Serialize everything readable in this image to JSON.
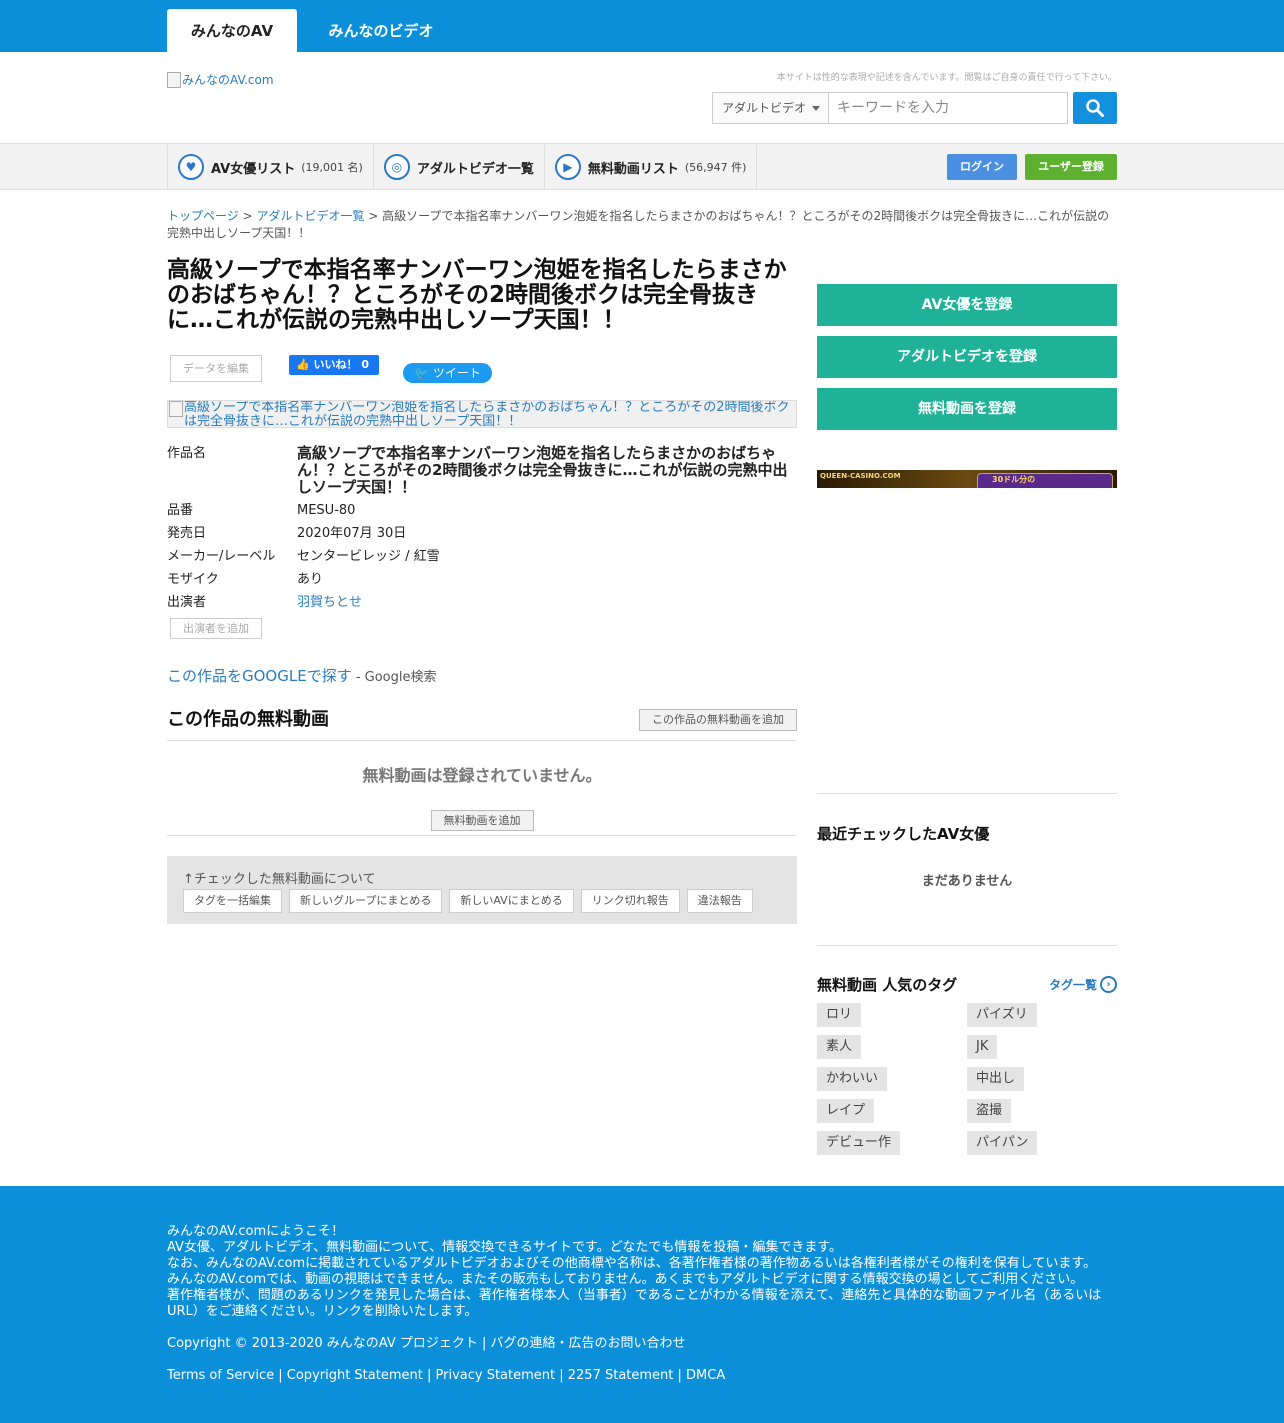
{
  "tabs": {
    "active": "みんなのAV",
    "inactive": "みんなのビデオ"
  },
  "header": {
    "logo_alt": "みんなのAV.com",
    "disclaimer": "本サイトは性的な表現や記述を含んでいます。閲覧はご自身の責任で行って下さい。",
    "search_select": "アダルトビデオ",
    "search_placeholder": "キーワードを入力"
  },
  "nav": {
    "items": [
      {
        "label": "AV女優リスト",
        "count": "(19,001 名)",
        "icon": "heart-icon"
      },
      {
        "label": "アダルトビデオ一覧",
        "count": "",
        "icon": "disc-icon"
      },
      {
        "label": "無料動画リスト",
        "count": "(56,947 件)",
        "icon": "play-icon"
      }
    ],
    "login": "ログイン",
    "register": "ユーザー登録"
  },
  "breadcrumb": {
    "home": "トップページ",
    "sep": " > ",
    "list": "アダルトビデオ一覧",
    "current": "高級ソープで本指名率ナンバーワン泡姫を指名したらまさかのおばちゃん！？ところがその2時間後ボクは完全骨抜きに…これが伝説の完熟中出しソープ天国！！"
  },
  "main": {
    "title": "高級ソープで本指名率ナンバーワン泡姫を指名したらまさかのおばちゃん！？ところがその2時間後ボクは完全骨抜きに…これが伝説の完熟中出しソープ天国！！",
    "edit_button": "データを編集",
    "like_button": "いいね！ 0",
    "tweet_button": "ツイート",
    "cover_alt": "高級ソープで本指名率ナンバーワン泡姫を指名したらまさかのおばちゃん！？ところがその2時間後ボクは完全骨抜きに…これが伝説の完熟中出しソープ天国！！",
    "info": {
      "title_label": "作品名",
      "title_value": "高級ソープで本指名率ナンバーワン泡姫を指名したらまさかのおばちゃん！？ところがその2時間後ボクは完全骨抜きに…これが伝説の完熟中出しソープ天国！！",
      "code_label": "品番",
      "code_value": "MESU-80",
      "date_label": "発売日",
      "date_value": "2020年07月 30日",
      "maker_label": "メーカー/レーベル",
      "maker_value": "センタービレッジ / 紅雪",
      "mosaic_label": "モザイク",
      "mosaic_value": "あり",
      "cast_label": "出演者",
      "cast_value": "羽賀ちとせ",
      "add_cast": "出演者を追加"
    },
    "google_link": "この作品をGOOGLEで探す",
    "google_sub": " - Google検索",
    "free_heading": "この作品の無料動画",
    "free_add_top": "この作品の無料動画を追加",
    "free_empty": "無料動画は登録されていません。",
    "free_add": "無料動画を追加",
    "checked_label": "↑チェックした無料動画について",
    "checked_buttons": [
      "タグを一括編集",
      "新しいグループにまとめる",
      "新しいAVにまとめる",
      "リンク切れ報告",
      "違法報告"
    ]
  },
  "sidebar": {
    "buttons": [
      "AV女優を登録",
      "アダルトビデオを登録",
      "無料動画を登録"
    ],
    "banner_text": "QUEEN-CASINO.COM",
    "banner_pill": "30ドル分の",
    "recent_heading": "最近チェックしたAV女優",
    "recent_empty": "まだありません",
    "tags_heading": "無料動画 人気のタグ",
    "tags_more": "タグ一覧",
    "tags": [
      "ロリ",
      "パイズリ",
      "素人",
      "JK",
      "かわいい",
      "中出し",
      "レイプ",
      "盗撮",
      "デビュー作",
      "パイパン"
    ]
  },
  "footer": {
    "lines": [
      "みんなのAV.comにようこそ！",
      "AV女優、アダルトビデオ、無料動画について、情報交換できるサイトです。どなたでも情報を投稿・編集できます。",
      "なお、みんなのAV.comに掲載されているアダルトビデオおよびその他商標や名称は、各著作権者様の著作物あるいは各権利者様がその権利を保有しています。",
      "みんなのAV.comでは、動画の視聴はできません。またその販売もしておりません。あくまでもアダルトビデオに関する情報交換の場としてご利用ください。",
      "著作権者様が、問題のあるリンクを発見した場合は、著作権者様本人（当事者）であることがわかる情報を添えて、連絡先と具体的な動画ファイル名（あるいはURL）をご連絡ください。リンクを削除いたします。"
    ],
    "copyright": "Copyright © 2013-2020 みんなのAV プロジェクト",
    "contact": "バグの連絡・広告のお問い合わせ",
    "links": [
      "Terms of Service",
      "Copyright Statement",
      "Privacy Statement",
      "2257 Statement",
      "DMCA"
    ]
  }
}
